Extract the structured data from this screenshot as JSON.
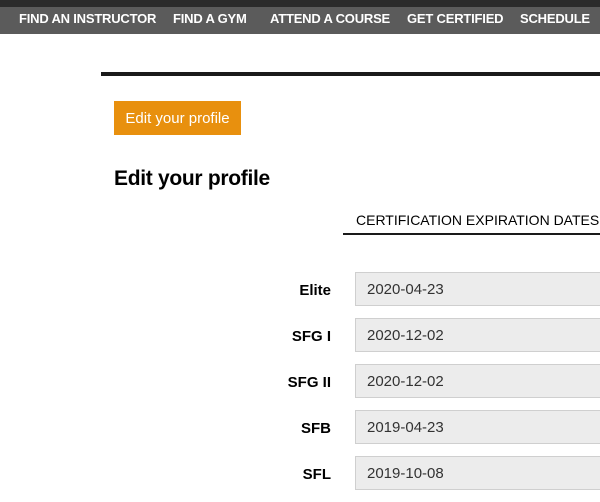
{
  "nav": {
    "items": [
      {
        "label": "FIND AN INSTRUCTOR"
      },
      {
        "label": "FIND A GYM"
      },
      {
        "label": "ATTEND A COURSE"
      },
      {
        "label": "GET CERTIFIED"
      },
      {
        "label": "SCHEDULE"
      }
    ]
  },
  "edit_button": {
    "label": "Edit your profile"
  },
  "page_title": "Edit your profile",
  "certifications": {
    "heading": "CERTIFICATION EXPIRATION DATES",
    "rows": [
      {
        "label": "Elite",
        "value": "2020-04-23"
      },
      {
        "label": "SFG I",
        "value": "2020-12-02"
      },
      {
        "label": "SFG II",
        "value": "2020-12-02"
      },
      {
        "label": "SFB",
        "value": "2019-04-23"
      },
      {
        "label": "SFL",
        "value": "2019-10-08"
      }
    ]
  },
  "colors": {
    "nav_background": "#5b5b5b",
    "nav_top_border": "#2b2b2b",
    "button_accent": "#e8900e",
    "input_background": "#ececec"
  }
}
